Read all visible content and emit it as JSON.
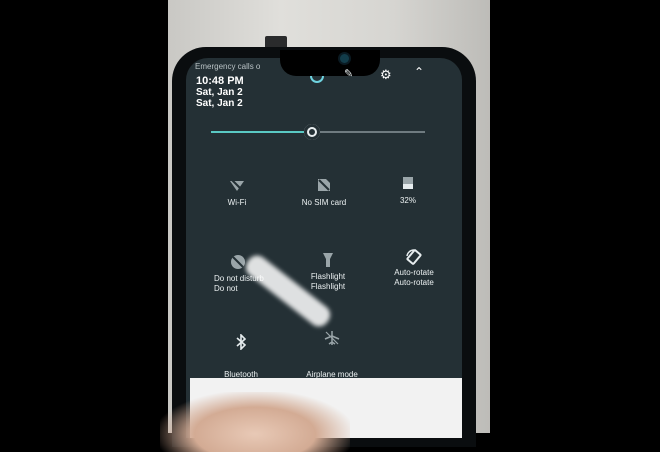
{
  "status": {
    "emergency_text": "Emergency calls o",
    "time": "10:48 PM",
    "date_primary": "Sat, Jan 2",
    "date_secondary": "Sat, Jan 2"
  },
  "header_icons": [
    "account-icon",
    "edit-icon",
    "settings-icon",
    "collapse-chevron-icon"
  ],
  "brightness": {
    "level": 0.47,
    "accent_color": "#5ac9c4"
  },
  "tiles": [
    {
      "label": "Wi-Fi",
      "icon": "wifi-off-icon"
    },
    {
      "label": "No SIM card",
      "icon": "no-sim-icon"
    },
    {
      "label": "32%",
      "icon": "battery-icon"
    },
    {
      "label": "Do not disturb",
      "label2": "Do not",
      "icon": "do-not-disturb-icon"
    },
    {
      "label": "Flashlight",
      "label2": "Flashlight",
      "icon": "flashlight-icon"
    },
    {
      "label": "Auto-rotate",
      "label2": "Auto-rotate",
      "icon": "auto-rotate-icon"
    },
    {
      "label": "Bluetooth",
      "icon": "bluetooth-icon"
    },
    {
      "label": "Airplane mode",
      "icon": "airplane-icon"
    }
  ]
}
